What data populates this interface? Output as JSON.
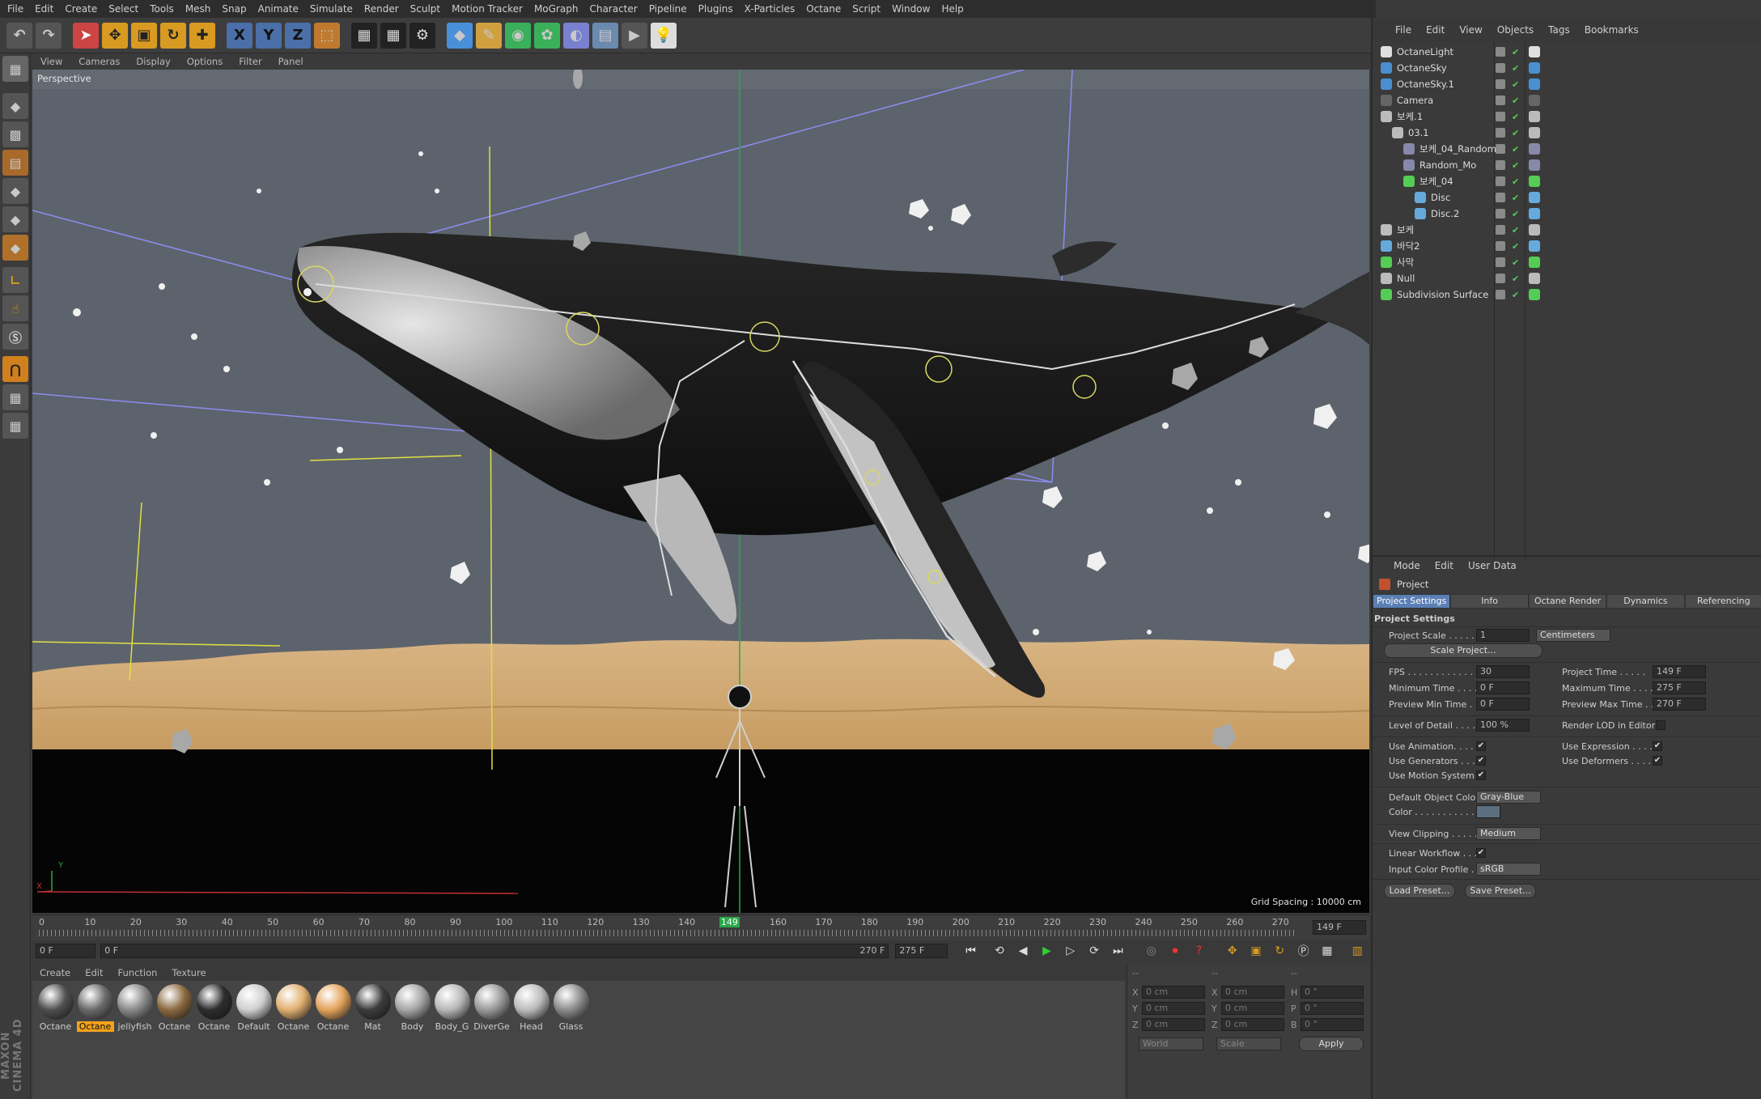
{
  "app": {
    "menu": [
      "File",
      "Edit",
      "Create",
      "Select",
      "Tools",
      "Mesh",
      "Snap",
      "Animate",
      "Simulate",
      "Render",
      "Sculpt",
      "Motion Tracker",
      "MoGraph",
      "Character",
      "Pipeline",
      "Plugins",
      "X-Particles",
      "Octane",
      "Script",
      "Window",
      "Help"
    ]
  },
  "toolbar": {
    "axis_x": "X",
    "axis_y": "Y",
    "axis_z": "Z"
  },
  "viewport": {
    "menu": [
      "View",
      "Cameras",
      "Display",
      "Options",
      "Filter",
      "Panel"
    ],
    "label": "Perspective",
    "grid_spacing": "Grid Spacing : 10000 cm",
    "axis_y": "Y",
    "axis_x": "X"
  },
  "timeline": {
    "ticks": [
      "0",
      "10",
      "20",
      "30",
      "40",
      "50",
      "60",
      "70",
      "80",
      "90",
      "100",
      "110",
      "120",
      "130",
      "140",
      "149",
      "160",
      "170",
      "180",
      "190",
      "200",
      "210",
      "220",
      "230",
      "240",
      "250",
      "260",
      "270"
    ],
    "current": "149 F"
  },
  "transport": {
    "start": "0 F",
    "range_start": "0 F",
    "range_end": "270 F",
    "end": "275 F"
  },
  "materials": {
    "menu": [
      "Create",
      "Edit",
      "Function",
      "Texture"
    ],
    "items": [
      {
        "label": "Octane",
        "color": "#505050"
      },
      {
        "label": "Octane",
        "color": "#6a6a6a",
        "selected": true
      },
      {
        "label": "jellyfish",
        "color": "#8a8a8a"
      },
      {
        "label": "Octane",
        "color": "#8b6a40"
      },
      {
        "label": "Octane",
        "color": "#2d2d2d"
      },
      {
        "label": "Default",
        "color": "#cfcfcf"
      },
      {
        "label": "Octane",
        "color": "#e0b070"
      },
      {
        "label": "Octane",
        "color": "#e3a45c"
      },
      {
        "label": "Mat",
        "color": "#3c3c3c"
      },
      {
        "label": "Body",
        "color": "#a6a6a6"
      },
      {
        "label": "Body_G",
        "color": "#b8b8b8"
      },
      {
        "label": "DiverGe",
        "color": "#9a9a9a"
      },
      {
        "label": "Head",
        "color": "#bcbcbc"
      },
      {
        "label": "Glass",
        "color": "#8c8c8c"
      }
    ]
  },
  "coords": {
    "header": [
      "--",
      "--",
      "--"
    ],
    "rows": [
      {
        "a": "X",
        "av": "0 cm",
        "b": "X",
        "bv": "0 cm",
        "c": "H",
        "cv": "0 °"
      },
      {
        "a": "Y",
        "av": "0 cm",
        "b": "Y",
        "bv": "0 cm",
        "c": "P",
        "cv": "0 °"
      },
      {
        "a": "Z",
        "av": "0 cm",
        "b": "Z",
        "bv": "0 cm",
        "c": "B",
        "cv": "0 °"
      }
    ],
    "world": "World",
    "scale": "Scale",
    "apply": "Apply"
  },
  "objects": {
    "menu": [
      "File",
      "Edit",
      "View",
      "Objects",
      "Tags",
      "Bookmarks"
    ],
    "rows": [
      {
        "name": "OctaneLight",
        "indent": 0,
        "color": "#e0e0e0"
      },
      {
        "name": "OctaneSky",
        "indent": 0,
        "color": "#4a8fd0"
      },
      {
        "name": "OctaneSky.1",
        "indent": 0,
        "color": "#4a8fd0"
      },
      {
        "name": "Camera",
        "indent": 0,
        "color": "#666"
      },
      {
        "name": "보케.1",
        "indent": 0,
        "color": "#bbb"
      },
      {
        "name": "03.1",
        "indent": 1,
        "color": "#bbb"
      },
      {
        "name": "보케_04_Random",
        "indent": 2,
        "color": "#88a"
      },
      {
        "name": "Random_Mo",
        "indent": 2,
        "color": "#88a"
      },
      {
        "name": "보케_04",
        "indent": 2,
        "color": "#5c5"
      },
      {
        "name": "Disc",
        "indent": 3,
        "color": "#6ad"
      },
      {
        "name": "Disc.2",
        "indent": 3,
        "color": "#6ad"
      },
      {
        "name": "보케",
        "indent": 0,
        "color": "#bbb"
      },
      {
        "name": "바닥2",
        "indent": 0,
        "color": "#6ad"
      },
      {
        "name": "사막",
        "indent": 0,
        "color": "#5c5"
      },
      {
        "name": "Null",
        "indent": 0,
        "color": "#bbb"
      },
      {
        "name": "Subdivision Surface",
        "indent": 0,
        "color": "#5c5"
      }
    ]
  },
  "attributes": {
    "menu": [
      "Mode",
      "Edit",
      "User Data"
    ],
    "object": "Project",
    "tabs": [
      "Project Settings",
      "Info",
      "Octane Render",
      "Dynamics",
      "Referencing"
    ],
    "section": "Project Settings",
    "project_scale_label": "Project Scale . . . . . .",
    "project_scale": "1",
    "units": "Centimeters",
    "scale_btn": "Scale Project...",
    "fps_label": "FPS . . . . . . . . . . . . . .",
    "fps": "30",
    "ptime_label": "Project Time . . . . .",
    "ptime": "149 F",
    "mintime_label": "Minimum Time . . . . .",
    "mintime": "0 F",
    "maxtime_label": "Maximum Time . . . .",
    "maxtime": "275 F",
    "pmin_label": "Preview Min Time . . .",
    "pmin": "0 F",
    "pmax_label": "Preview Max Time . .",
    "pmax": "270 F",
    "lod_label": "Level of Detail . . . . .",
    "lod": "100 %",
    "renderlod_label": "Render LOD in Editor",
    "useanim_label": "Use Animation. . . . .",
    "useexpr_label": "Use Expression . . . . .",
    "usegen_label": "Use Generators . . . .",
    "usedef_label": "Use Deformers . . . . .",
    "usemotion_label": "Use Motion System",
    "defcolor_label": "Default Object Color",
    "defcolor": "Gray-Blue",
    "color_label": "Color . . . . . . . . . . . .",
    "clip_label": "View Clipping . . . . .",
    "clip": "Medium",
    "linear_label": "Linear Workflow . . .",
    "icp_label": "Input Color Profile . .",
    "icp": "sRGB",
    "load": "Load Preset...",
    "save": "Save Preset..."
  }
}
